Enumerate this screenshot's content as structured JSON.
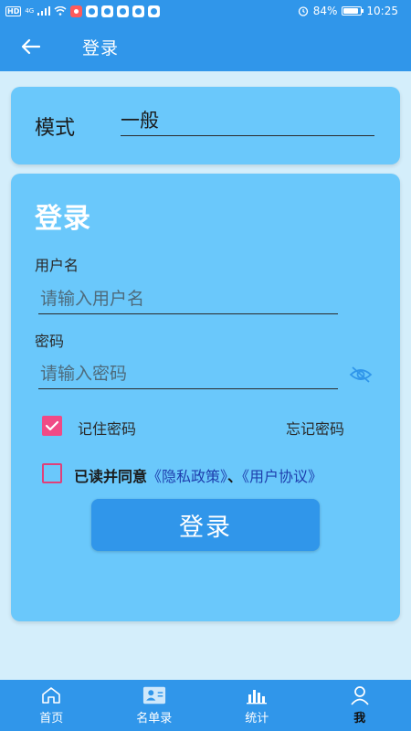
{
  "status_bar": {
    "hd_label": "HD",
    "network_label": "4G",
    "battery_percent": "84%",
    "time": "10:25"
  },
  "app_bar": {
    "title": "登录"
  },
  "mode": {
    "label": "模式",
    "value": "一般"
  },
  "login": {
    "heading": "登录",
    "username_label": "用户名",
    "username_placeholder": "请输入用户名",
    "password_label": "密码",
    "password_placeholder": "请输入密码",
    "remember_label": "记住密码",
    "remember_checked": true,
    "forgot_label": "忘记密码",
    "agree_prefix": "已读并同意",
    "privacy_link": "《隐私政策》",
    "separator": "、",
    "agreement_link": "《用户协议》",
    "agree_checked": false,
    "submit_label": "登录"
  },
  "bottom_nav": {
    "items": [
      {
        "label": "首页"
      },
      {
        "label": "名单录"
      },
      {
        "label": "统计"
      },
      {
        "label": "我"
      }
    ],
    "active_index": 3
  },
  "colors": {
    "primary": "#3096ea",
    "card": "#6ac8fb",
    "background": "#d4eefb",
    "checkbox": "#f04a86",
    "link": "#1e3fae"
  }
}
